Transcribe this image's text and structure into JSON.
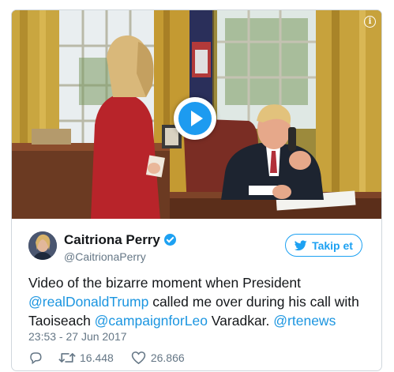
{
  "media": {
    "type": "video",
    "play_icon": "play-icon",
    "info_icon": "info-icon",
    "info_glyph": "i"
  },
  "author": {
    "name": "Caitriona Perry",
    "handle": "@CaitrionaPerry",
    "verified": true
  },
  "follow_button": {
    "label": "Takip et",
    "icon": "twitter-bird-icon"
  },
  "tweet": {
    "text_parts": [
      {
        "text": "Video of the bizarre moment when President ",
        "link": false
      },
      {
        "text": "@realDonaldTrump",
        "link": true
      },
      {
        "text": " called me over during his call with Taoiseach ",
        "link": false
      },
      {
        "text": "@campaignforLeo",
        "link": true
      },
      {
        "text": " Varadkar. ",
        "link": false
      },
      {
        "text": "@rtenews",
        "link": true
      }
    ],
    "timestamp": "23:53 - 27 Jun 2017"
  },
  "actions": {
    "reply_icon": "reply-icon",
    "retweet_icon": "retweet-icon",
    "retweet_count": "16.448",
    "like_icon": "heart-icon",
    "like_count": "26.866"
  },
  "colors": {
    "accent": "#1da1f2",
    "link": "#1b95e0",
    "secondary_text": "#657786"
  }
}
